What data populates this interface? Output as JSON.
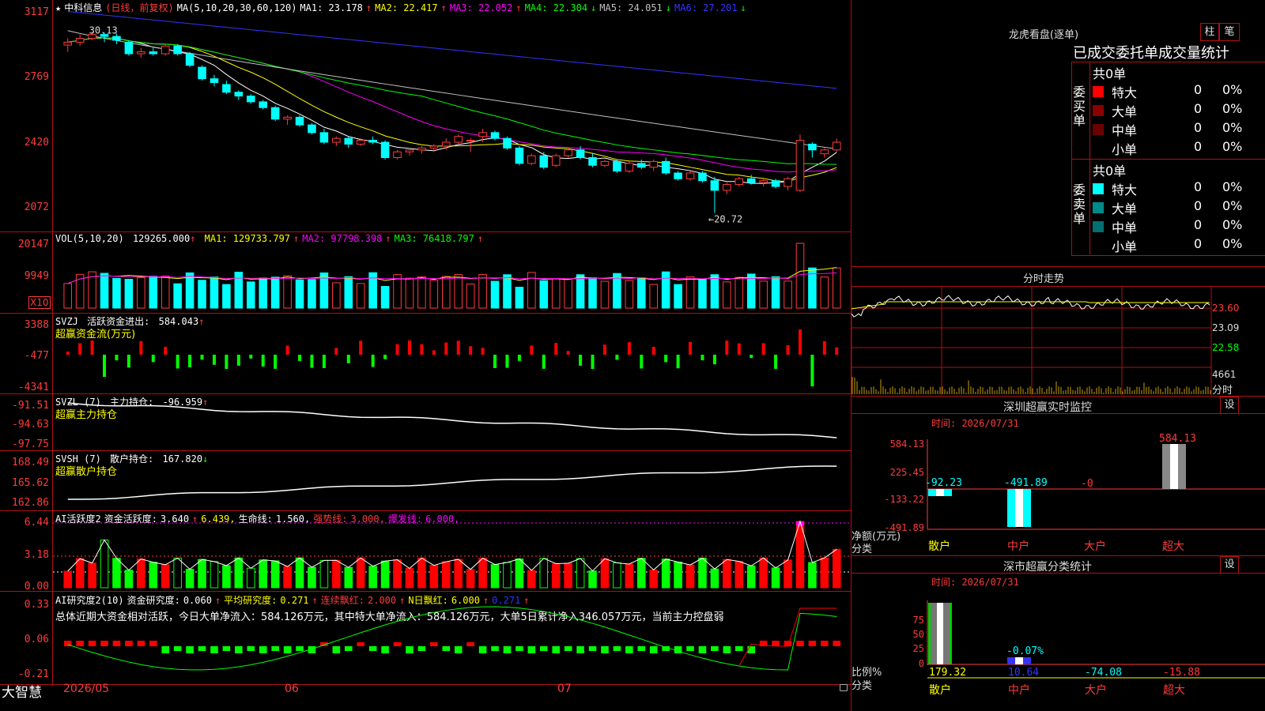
{
  "chart_data": {
    "type": "candlestick",
    "stock_name": "中科信息",
    "period": "(日线，前复权)",
    "price_axis": {
      "ticks": [
        "3117",
        "2769",
        "2420",
        "2072"
      ]
    },
    "ma_legend": {
      "label": "MA(5,10,20,30,60,120)",
      "items": [
        {
          "name": "MA1:",
          "value": "23.178",
          "arrow": "↑",
          "color": "#ffffff"
        },
        {
          "name": "MA2:",
          "value": "22.417",
          "arrow": "↑",
          "color": "#ffff00"
        },
        {
          "name": "MA3:",
          "value": "22.052",
          "arrow": "↑",
          "color": "#ff00ff"
        },
        {
          "name": "MA4:",
          "value": "22.304",
          "arrow": "↓",
          "color": "#00ff00"
        },
        {
          "name": "MA5:",
          "value": "24.051",
          "arrow": "↓",
          "color": "#c0c0c0"
        },
        {
          "name": "MA6:",
          "value": "27.201",
          "arrow": "↓",
          "color": "#3333ff"
        }
      ]
    },
    "high_label": "30.13",
    "low_label": "←20.72",
    "candles": [
      [
        29.45,
        29.8,
        29.1,
        29.6
      ],
      [
        29.6,
        30.0,
        29.4,
        29.8
      ],
      [
        29.8,
        30.13,
        29.7,
        30.0
      ],
      [
        30.0,
        30.1,
        29.6,
        29.9
      ],
      [
        29.9,
        30.05,
        29.5,
        29.7
      ],
      [
        29.6,
        29.7,
        28.9,
        29.0
      ],
      [
        29.0,
        29.3,
        28.8,
        29.1
      ],
      [
        29.1,
        29.3,
        28.9,
        29.0
      ],
      [
        29.0,
        29.5,
        28.9,
        29.4
      ],
      [
        29.4,
        29.5,
        28.9,
        29.0
      ],
      [
        29.0,
        29.1,
        28.3,
        28.4
      ],
      [
        28.3,
        28.4,
        27.6,
        27.7
      ],
      [
        27.7,
        27.9,
        27.3,
        27.5
      ],
      [
        27.4,
        27.6,
        26.9,
        27.0
      ],
      [
        27.0,
        27.1,
        26.6,
        26.8
      ],
      [
        26.8,
        26.9,
        26.4,
        26.5
      ],
      [
        26.5,
        26.6,
        26.1,
        26.2
      ],
      [
        26.2,
        26.3,
        25.5,
        25.6
      ],
      [
        25.6,
        25.8,
        25.3,
        25.7
      ],
      [
        25.7,
        25.8,
        25.2,
        25.3
      ],
      [
        25.3,
        25.4,
        24.8,
        24.9
      ],
      [
        24.9,
        25.1,
        24.3,
        24.4
      ],
      [
        24.4,
        24.7,
        24.2,
        24.6
      ],
      [
        24.6,
        24.7,
        24.1,
        24.3
      ],
      [
        24.3,
        24.6,
        24.2,
        24.5
      ],
      [
        24.5,
        24.7,
        24.3,
        24.4
      ],
      [
        24.4,
        24.5,
        23.5,
        23.6
      ],
      [
        23.6,
        24.0,
        23.5,
        23.9
      ],
      [
        23.9,
        24.1,
        23.7,
        24.0
      ],
      [
        24.0,
        24.2,
        23.8,
        24.1
      ],
      [
        24.1,
        24.3,
        23.9,
        24.2
      ],
      [
        24.2,
        24.6,
        24.0,
        24.4
      ],
      [
        24.4,
        24.8,
        24.3,
        24.7
      ],
      [
        24.5,
        24.6,
        23.9,
        24.5
      ],
      [
        24.7,
        25.1,
        24.4,
        24.9
      ],
      [
        24.9,
        25.0,
        24.5,
        24.6
      ],
      [
        24.6,
        24.7,
        24.0,
        24.1
      ],
      [
        24.1,
        24.2,
        23.2,
        23.3
      ],
      [
        23.3,
        23.8,
        23.2,
        23.7
      ],
      [
        23.7,
        23.9,
        23.0,
        23.1
      ],
      [
        23.2,
        23.8,
        23.1,
        23.7
      ],
      [
        23.7,
        24.1,
        23.6,
        24.0
      ],
      [
        24.0,
        24.2,
        23.5,
        23.6
      ],
      [
        23.6,
        23.8,
        23.1,
        23.2
      ],
      [
        23.2,
        23.5,
        23.1,
        23.4
      ],
      [
        23.4,
        23.5,
        22.8,
        22.9
      ],
      [
        22.9,
        23.4,
        22.8,
        23.3
      ],
      [
        23.3,
        23.5,
        23.0,
        23.1
      ],
      [
        23.1,
        23.5,
        22.9,
        23.4
      ],
      [
        23.4,
        23.6,
        22.7,
        22.8
      ],
      [
        22.8,
        22.9,
        22.4,
        22.5
      ],
      [
        22.5,
        22.9,
        22.4,
        22.8
      ],
      [
        22.8,
        22.9,
        22.3,
        22.4
      ],
      [
        22.4,
        22.6,
        20.72,
        21.9
      ],
      [
        21.9,
        22.3,
        21.7,
        22.2
      ],
      [
        22.2,
        22.6,
        22.1,
        22.5
      ],
      [
        22.5,
        22.7,
        22.2,
        22.3
      ],
      [
        22.3,
        22.5,
        22.1,
        22.4
      ],
      [
        22.4,
        22.5,
        22.0,
        22.1
      ],
      [
        22.1,
        22.6,
        21.9,
        22.5
      ],
      [
        21.9,
        24.8,
        21.8,
        24.5
      ],
      [
        24.3,
        24.4,
        23.6,
        24.0
      ],
      [
        23.8,
        24.1,
        23.6,
        24.0
      ],
      [
        24.0,
        24.6,
        23.9,
        24.4
      ]
    ],
    "volume": {
      "label": "VOL(5,10,20)",
      "value": "129265.000",
      "arrow": "↑",
      "ticks": [
        "20147",
        "9949"
      ],
      "unit": "X10",
      "ma": [
        {
          "name": "MA1:",
          "value": "129733.797",
          "arrow": "↑",
          "color": "#ffff00"
        },
        {
          "name": "MA2:",
          "value": "97798.398",
          "arrow": "↑",
          "color": "#ff00ff"
        },
        {
          "name": "MA3:",
          "value": "76418.797",
          "arrow": "↑",
          "color": "#00ff00"
        }
      ]
    },
    "svzj": {
      "label": "SVZJ",
      "desc": "活跃资金进出:",
      "value": "584.043",
      "arrow": "↑",
      "sub": "超赢资金流(万元)",
      "ticks": [
        "3388",
        "-477",
        "-4341"
      ]
    },
    "svzl": {
      "label": "SVZL (7)",
      "desc": "主力持仓:",
      "value": "-96.959",
      "arrow": "↑",
      "sub": "超赢主力持仓",
      "ticks": [
        "-91.51",
        "-94.63",
        "-97.75"
      ]
    },
    "svsh": {
      "label": "SVSH (7)",
      "desc": "散户持仓:",
      "value": "167.820",
      "arrow": "↓",
      "sub": "超赢散户持仓",
      "ticks": [
        "168.49",
        "165.62",
        "162.86"
      ]
    },
    "ai_active": {
      "label": "AI活跃度2",
      "items": [
        {
          "text": "资金活跃度:",
          "color": "#ffffff"
        },
        {
          "text": "3.640",
          "color": "#ffffff"
        },
        {
          "text": "↑",
          "color": "#ff3b3b"
        },
        {
          "text": "6.439,",
          "color": "#ffff00"
        },
        {
          "text": "生命线:",
          "color": "#ffffff"
        },
        {
          "text": "1.560,",
          "color": "#ffffff"
        },
        {
          "text": "强势线:",
          "color": "#ff3b3b"
        },
        {
          "text": "3.000,",
          "color": "#ff3b3b"
        },
        {
          "text": "爆发线:",
          "color": "#ff00ff"
        },
        {
          "text": "6.000,",
          "color": "#ff00ff"
        }
      ],
      "ticks": [
        "6.44",
        "3.18",
        "0.00"
      ]
    },
    "ai_research": {
      "label": "AI研究度2(10)",
      "items": [
        {
          "text": "资金研究度:",
          "color": "#ffffff"
        },
        {
          "text": "0.060",
          "color": "#ffffff"
        },
        {
          "text": "↑",
          "color": "#ff3b3b"
        },
        {
          "text": "平均研究度:",
          "color": "#ffff00"
        },
        {
          "text": "0.271",
          "color": "#ffff00"
        },
        {
          "text": "↑",
          "color": "#ff3b3b"
        },
        {
          "text": "连续飘红:",
          "color": "#ff3b3b"
        },
        {
          "text": "2.000",
          "color": "#ff3b3b"
        },
        {
          "text": "↑",
          "color": "#ff3b3b"
        },
        {
          "text": "N日飘红:",
          "color": "#ffff00"
        },
        {
          "text": "6.000",
          "color": "#ffff00"
        },
        {
          "text": "↑",
          "color": "#ff3b3b"
        },
        {
          "text": "0.271",
          "color": "#3333ff"
        },
        {
          "text": "↑",
          "color": "#ff3b3b"
        }
      ],
      "summary": "总体近期大资金相对活跃，今日大单净流入：584.126万元，其中特大单净流入：584.126万元，大单5日累计净入346.057万元，当前主力控盘弱",
      "ticks": [
        "0.33",
        "0.06",
        "-0.21"
      ]
    },
    "x_axis": [
      "2026/05",
      "06",
      "07"
    ]
  },
  "bottom_left": "大智慧",
  "right_panel": {
    "dragon": {
      "title": "龙虎看盘(逐单)",
      "btn_bar": "柱",
      "btn_pen": "笔",
      "heading": "已成交委托单成交量统计",
      "buy": {
        "side": "委买单",
        "total": "共0单",
        "rows": [
          {
            "name": "特大",
            "count": "0",
            "pct": "0%",
            "color": "#ff0000"
          },
          {
            "name": "大单",
            "count": "0",
            "pct": "0%",
            "color": "#8b0000"
          },
          {
            "name": "中单",
            "count": "0",
            "pct": "0%",
            "color": "#6b0000"
          },
          {
            "name": "小单",
            "count": "0",
            "pct": "0%",
            "color": "#000000"
          }
        ]
      },
      "sell": {
        "side": "委卖单",
        "total": "共0单",
        "rows": [
          {
            "name": "特大",
            "count": "0",
            "pct": "0%",
            "color": "#00ffff"
          },
          {
            "name": "大单",
            "count": "0",
            "pct": "0%",
            "color": "#008b8b"
          },
          {
            "name": "中单",
            "count": "0",
            "pct": "0%",
            "color": "#007070"
          },
          {
            "name": "小单",
            "count": "0",
            "pct": "0%",
            "color": "#000000"
          }
        ]
      }
    },
    "intraday": {
      "title": "分时走势",
      "price_ticks": [
        "23.60",
        "23.09",
        "22.58"
      ],
      "vol_tick": "4661",
      "vol_label": "分时"
    },
    "sz_monitor": {
      "title": "深圳超赢实时监控",
      "settings": "设",
      "time": "时间: 2026/07/31",
      "axis_label": "净额(万元)",
      "class_label": "分类",
      "ticks": [
        "584.13",
        "225.45",
        "-133.22",
        "-491.89"
      ],
      "bars": [
        {
          "cat": "散户",
          "value": -92.23,
          "label": "-92.23"
        },
        {
          "cat": "中户",
          "value": -491.89,
          "label": "-491.89"
        },
        {
          "cat": "大户",
          "value": -0.0,
          "label": "-0"
        },
        {
          "cat": "超大",
          "value": 584.13,
          "label": "584.13"
        }
      ]
    },
    "sz_class": {
      "title": "深市超赢分类统计",
      "settings": "设",
      "time": "时间: 2026/07/31",
      "axis_label": "比例%",
      "class_label": "分类",
      "ticks": [
        "75",
        "50",
        "25",
        "0"
      ],
      "bars": [
        {
          "cat": "散户",
          "value": 179.32,
          "label": "179.32"
        },
        {
          "cat": "中户",
          "value": 10.64,
          "label": "10.64"
        },
        {
          "cat": "大户",
          "value": -74.08,
          "label": "-74.08"
        },
        {
          "cat": "超大",
          "value": -15.88,
          "label": "-15.88"
        }
      ],
      "note": "-0.07%"
    }
  }
}
